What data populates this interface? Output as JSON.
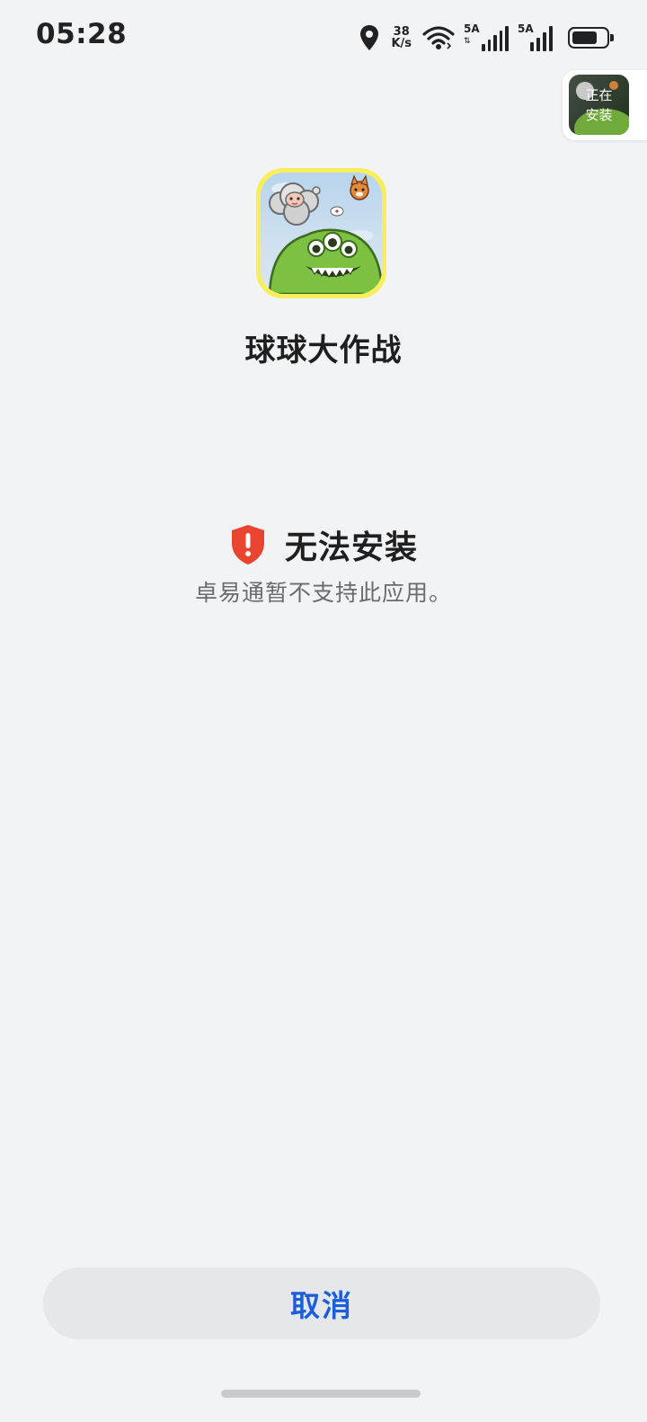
{
  "status_bar": {
    "time": "05:28",
    "net_speed_value": "38",
    "net_speed_unit": "K/s",
    "sim1_label": "5A",
    "sim2_label": "5A",
    "battery_level": 0.75
  },
  "floating_widget": {
    "label": "正在安装"
  },
  "app": {
    "name": "球球大作战"
  },
  "error": {
    "title": "无法安装",
    "message": "卓易通暂不支持此应用。",
    "icon": "shield-alert-icon",
    "color": "#e8442f"
  },
  "actions": {
    "cancel_label": "取消",
    "accent_color": "#1a5fd8"
  }
}
